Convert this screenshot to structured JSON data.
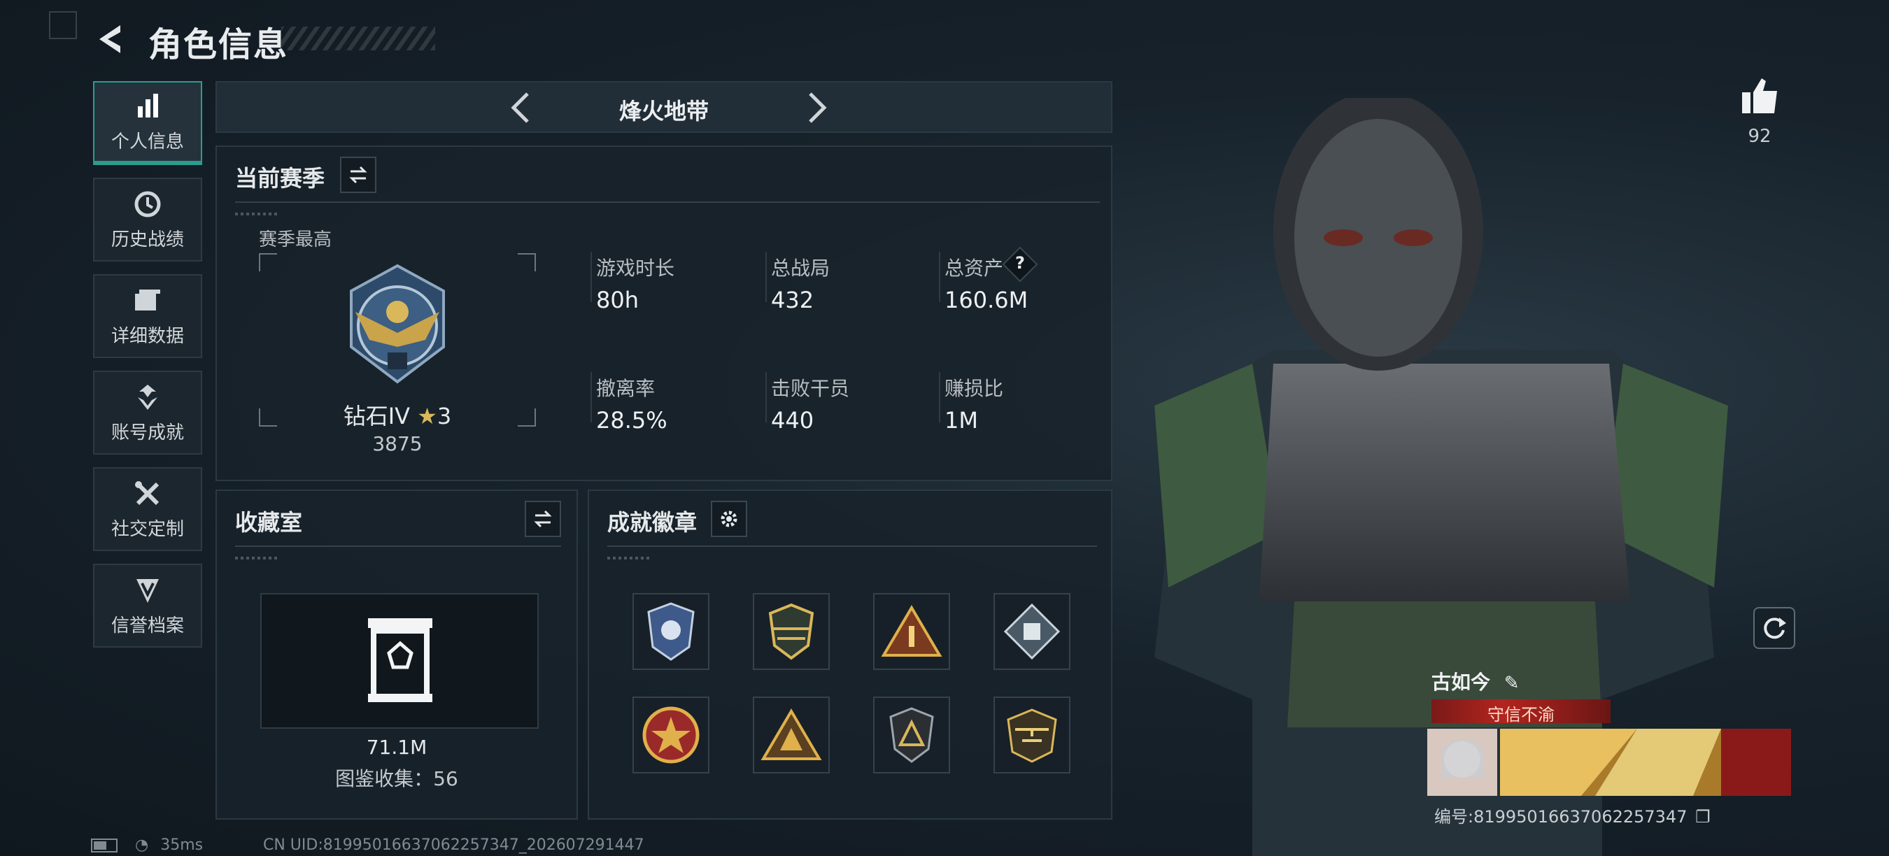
{
  "header": {
    "title": "角色信息"
  },
  "sidebar": {
    "items": [
      {
        "label": "个人信息",
        "icon": "bar-chart-icon",
        "active": true
      },
      {
        "label": "历史战绩",
        "icon": "clock-icon"
      },
      {
        "label": "详细数据",
        "icon": "folder-icon"
      },
      {
        "label": "账号成就",
        "icon": "achievement-icon"
      },
      {
        "label": "社交定制",
        "icon": "tools-icon"
      },
      {
        "label": "信誉档案",
        "icon": "shield-emblem-icon"
      }
    ]
  },
  "mode": {
    "label": "烽火地带"
  },
  "season": {
    "title": "当前赛季",
    "best_label": "赛季最高",
    "rank_name": "钻石IV",
    "rank_stars": "3",
    "rank_points": "3875",
    "stats": [
      {
        "label": "游戏时长",
        "value": "80h"
      },
      {
        "label": "总战局",
        "value": "432"
      },
      {
        "label": "总资产",
        "value": "160.6M",
        "help": "?"
      },
      {
        "label": "撤离率",
        "value": "28.5%"
      },
      {
        "label": "击败干员",
        "value": "440"
      },
      {
        "label": "赚损比",
        "value": "1M"
      }
    ]
  },
  "collection": {
    "title": "收藏室",
    "value": "71.1M",
    "catalog_text": "图鉴收集：56"
  },
  "badges": {
    "title": "成就徽章",
    "items": [
      "police-badge-icon",
      "shield-wings-icon",
      "triangle-one-icon",
      "diamond-dice-icon",
      "star-medal-icon",
      "triangle-group-icon",
      "shield-triangle-icon",
      "helicopter-badge-icon"
    ]
  },
  "profile": {
    "likes": "92",
    "player_name": "古如今",
    "title_badge": "守信不渝",
    "uid_label": "编号:81995016637062257347"
  },
  "status": {
    "ping": "35ms",
    "uid_line": "CN UID:81995016637062257347_202607291447"
  },
  "colors": {
    "accent": "#2a9d8f",
    "banner_red": "#b3241f",
    "panel_bg": "#18222a"
  }
}
